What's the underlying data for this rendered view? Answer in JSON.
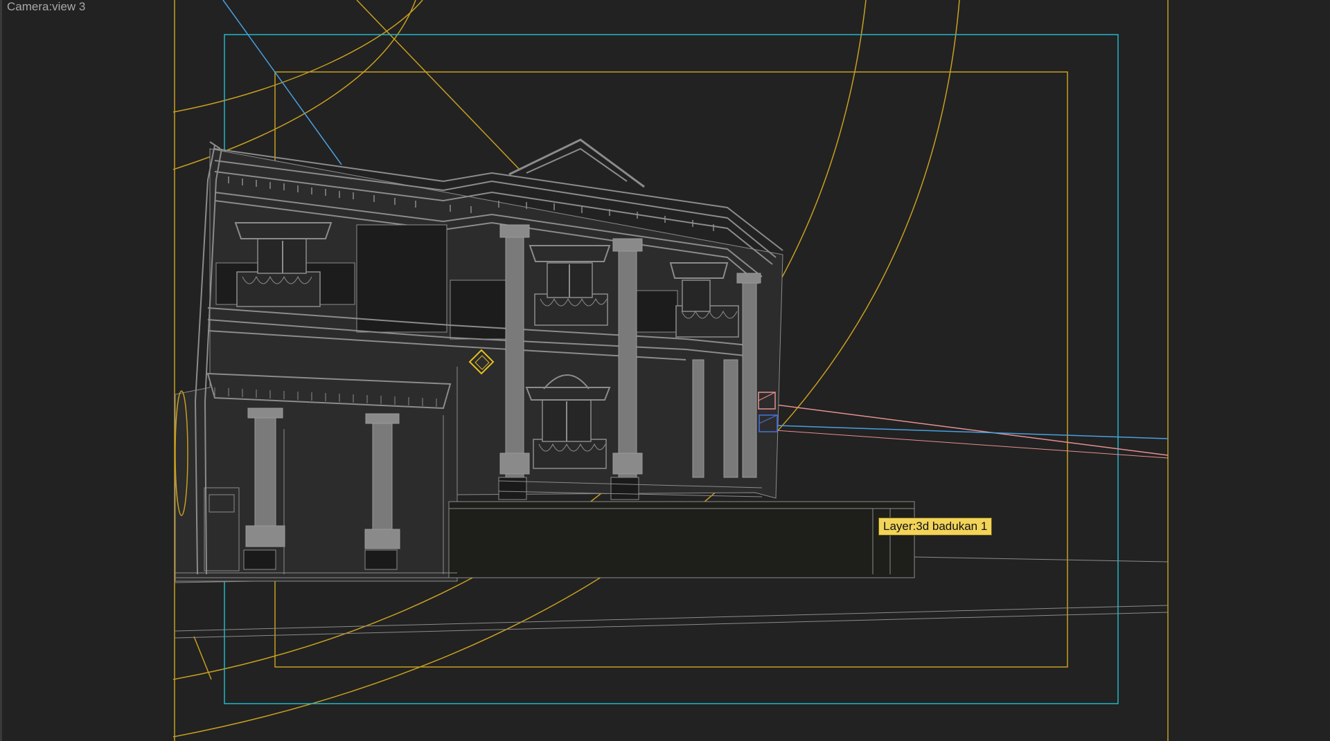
{
  "viewport": {
    "label": "Camera:view 3",
    "background": "#222222"
  },
  "tooltip": {
    "text": "Layer:3d badukan 1",
    "background": "#f2d45a"
  },
  "colors": {
    "safe_frame_outer": "#22b8c8",
    "safe_frame_inner": "#c8a020",
    "camera_cone": "#c8a020",
    "wireframe": "#8c8c8c",
    "light_line_red": "#e89090",
    "light_line_blue": "#4aa0e0"
  },
  "icons": {
    "target_marker": "diamond-target-icon",
    "light_gizmo_red": "light-gizmo-icon",
    "light_gizmo_blue": "light-gizmo-icon"
  }
}
